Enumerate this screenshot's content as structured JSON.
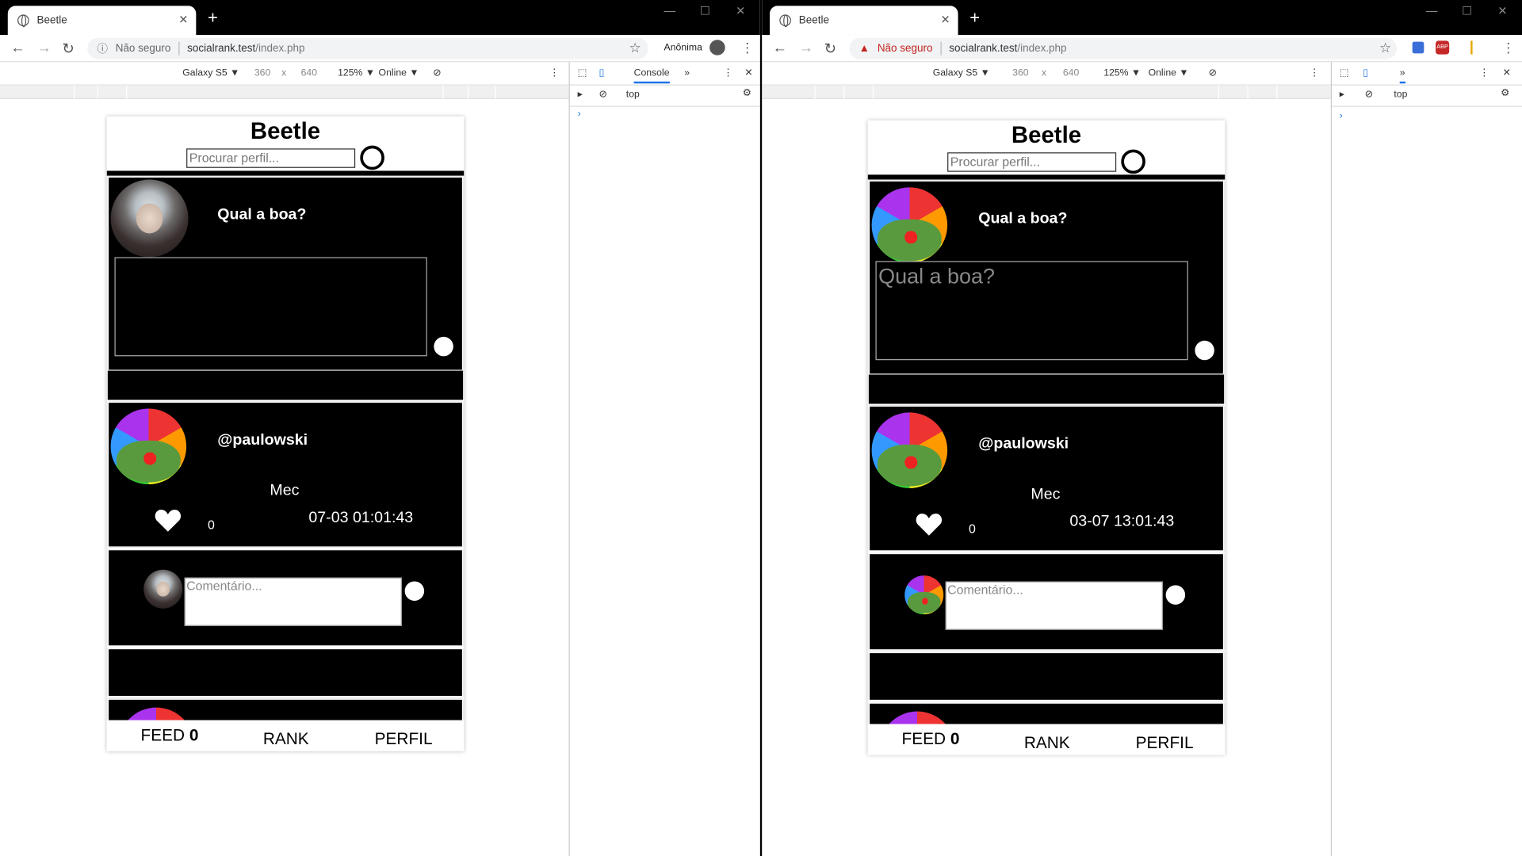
{
  "windows": [
    {
      "tab_title": "Beetle",
      "security": "Não seguro",
      "warn": false,
      "url_host": "socialrank.test",
      "url_path": "/index.php",
      "profile": "Anônima",
      "device": "Galaxy S5 ▼",
      "width": "360",
      "times": "x",
      "height": "640",
      "zoom": "125% ▼",
      "network": "Online ▼",
      "devtools_tab": "Console",
      "context": "top",
      "app": {
        "title": "Beetle",
        "search_placeholder": "Procurar perfil...",
        "composer_heading": "Qual a boa?",
        "composer_placeholder": "",
        "post_user": "@paulowski",
        "post_text": "Mec",
        "like_count": "0",
        "post_time": "07-03 01:01:43",
        "comment_placeholder": "Comentário...",
        "nav_feed": "FEED",
        "nav_feed_count": "0",
        "nav_rank": "RANK",
        "nav_profile": "PERFIL"
      }
    },
    {
      "tab_title": "Beetle",
      "security": "Não seguro",
      "warn": true,
      "url_host": "socialrank.test",
      "url_path": "/index.php",
      "device": "Galaxy S5 ▼",
      "width": "360",
      "times": "x",
      "height": "640",
      "zoom": "125% ▼",
      "network": "Online ▼",
      "context": "top",
      "app": {
        "title": "Beetle",
        "search_placeholder": "Procurar perfil...",
        "composer_heading": "Qual a boa?",
        "composer_placeholder": "Qual a boa?",
        "post_user": "@paulowski",
        "post_text": "Mec",
        "like_count": "0",
        "post_time": "03-07 13:01:43",
        "comment_placeholder": "Comentário...",
        "nav_feed": "FEED",
        "nav_feed_count": "0",
        "nav_rank": "RANK",
        "nav_profile": "PERFIL"
      }
    }
  ]
}
